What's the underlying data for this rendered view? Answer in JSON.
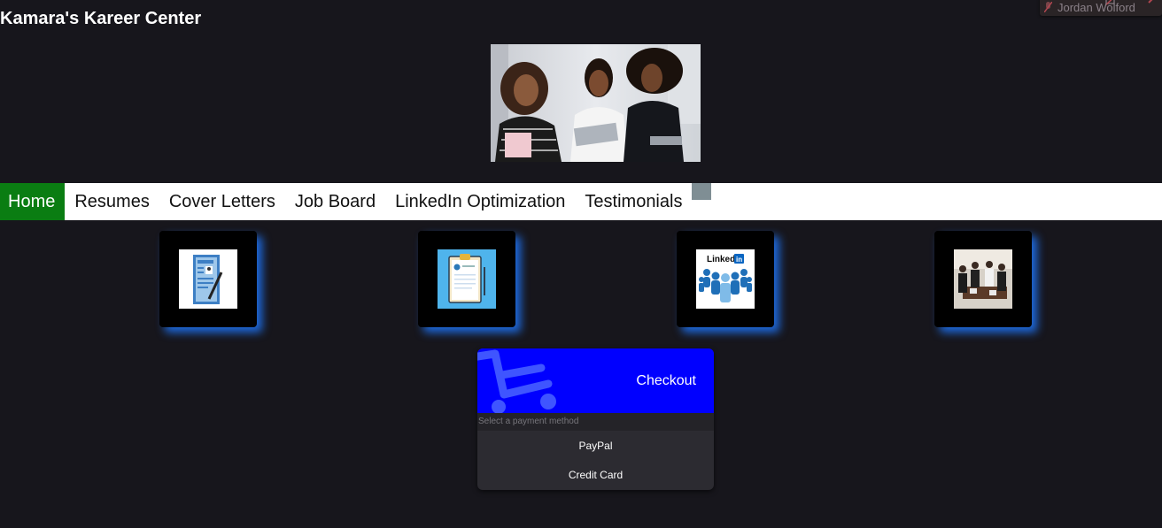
{
  "site": {
    "title": "Kamara's Kareer Center"
  },
  "video_call": {
    "participant": "Jordan Wolford"
  },
  "nav": {
    "items": [
      {
        "label": "Home",
        "active": true
      },
      {
        "label": "Resumes"
      },
      {
        "label": "Cover Letters"
      },
      {
        "label": "Job Board"
      },
      {
        "label": "LinkedIn Optimization"
      },
      {
        "label": "Testimonials"
      }
    ],
    "active_color": "#0a7d12"
  },
  "service_cards": [
    {
      "icon": "resume-icon"
    },
    {
      "icon": "clipboard-icon"
    },
    {
      "icon": "linkedin-icon",
      "logo_text": "Linked",
      "logo_badge": "in"
    },
    {
      "icon": "meeting-photo-icon"
    }
  ],
  "checkout": {
    "title": "Checkout",
    "prompt": "Select a payment method",
    "options": [
      "PayPal",
      "Credit Card"
    ],
    "banner_color": "#0000ff"
  }
}
